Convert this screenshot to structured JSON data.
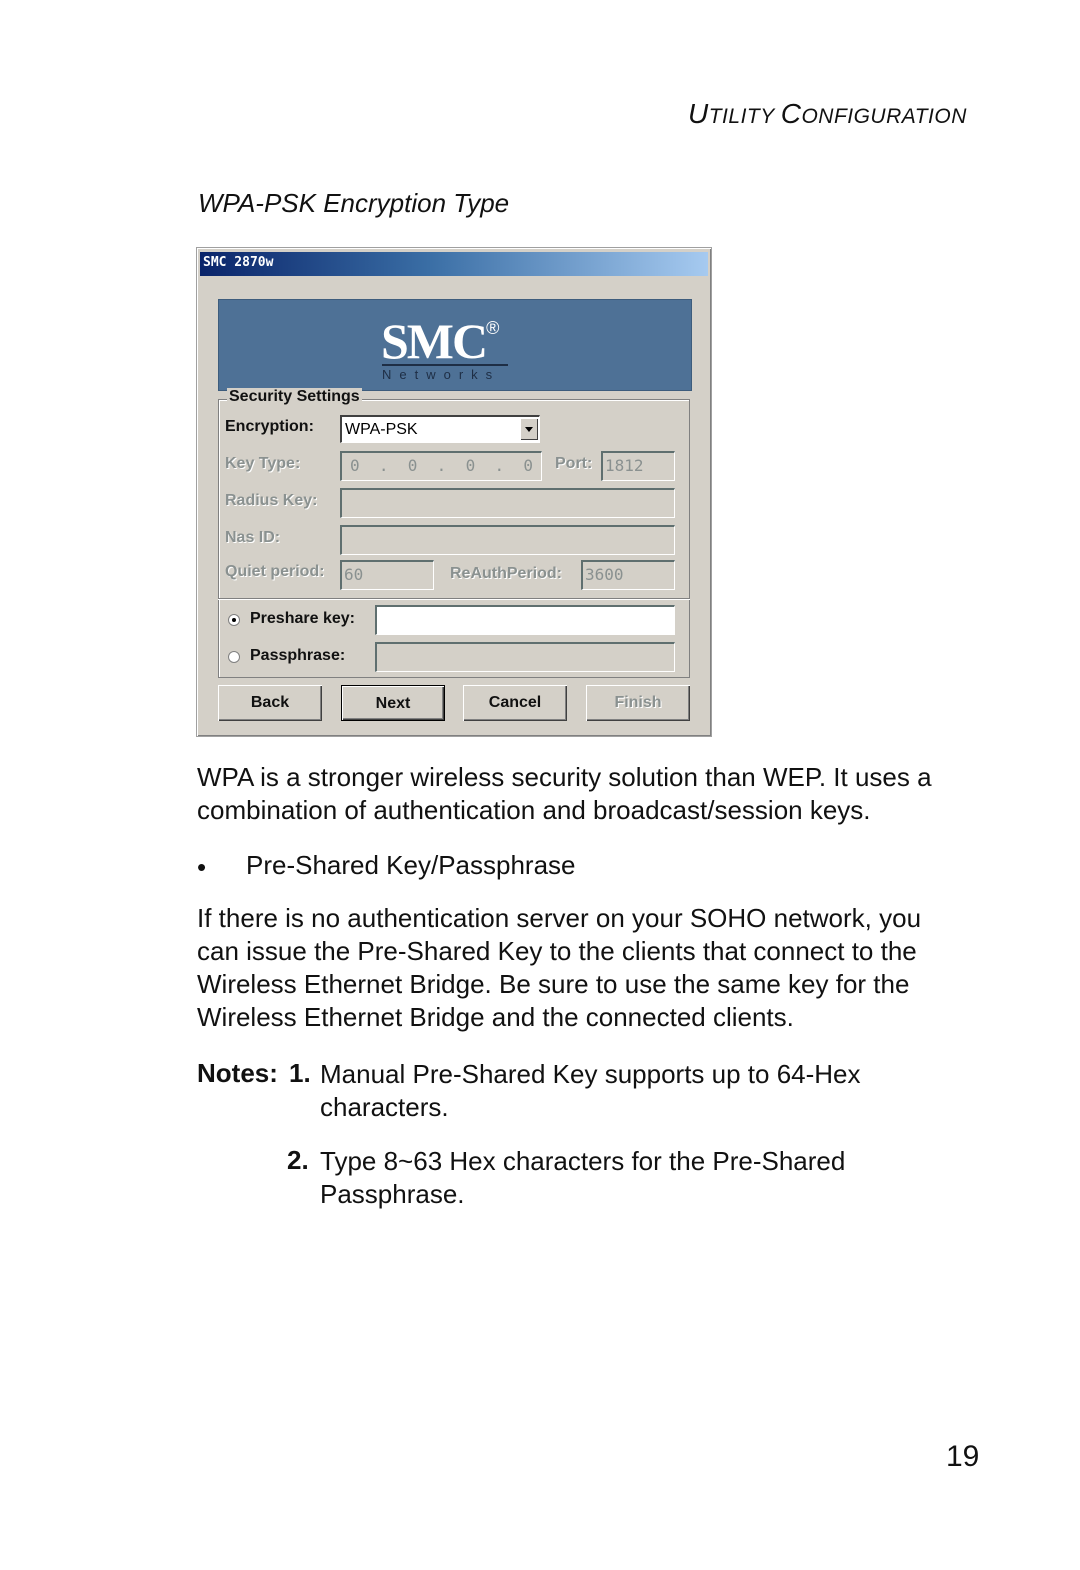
{
  "header": {
    "section_first_U": "U",
    "section_rest1": "TILITY ",
    "section_first_C": "C",
    "section_rest2": "ONFIGURATION"
  },
  "caption": "WPA-PSK Encryption Type",
  "dialog": {
    "title": "SMC 2870w",
    "logo": "SMC",
    "logo_mark": "®",
    "logo_sub": "Networks",
    "group_title": "Security Settings",
    "encryption_label": "Encryption:",
    "encryption_value": "WPA-PSK",
    "key_type_label": "Key Type:",
    "key_type_value": "0  .  0  .  0  .  0",
    "port_label": "Port:",
    "port_value": "1812",
    "radius_key_label": "Radius Key:",
    "radius_key_value": "",
    "nas_id_label": "Nas ID:",
    "nas_id_value": "",
    "quiet_period_label": "Quiet period:",
    "quiet_period_value": "60",
    "reauth_label": "ReAuthPeriod:",
    "reauth_value": "3600",
    "preshare_label": "Preshare key:",
    "preshare_value": "",
    "preshare_selected": true,
    "passphrase_label": "Passphrase:",
    "passphrase_value": "",
    "buttons": {
      "back": "Back",
      "next": "Next",
      "cancel": "Cancel",
      "finish": "Finish"
    }
  },
  "body": {
    "para1": "WPA is a stronger wireless security solution than WEP. It uses a combination of authentication and broadcast/session keys.",
    "bullet_symbol": "•",
    "bullet": "Pre-Shared Key/Passphrase",
    "para2": "If there is no authentication server on your SOHO network, you can issue the Pre-Shared Key to the clients that connect to the Wireless Ethernet Bridge. Be sure to use the same key for the Wireless Ethernet Bridge and the connected clients.",
    "notes_label": "Notes:",
    "notes": [
      {
        "num": "1.",
        "text": "Manual Pre-Shared Key supports up to 64-Hex characters."
      },
      {
        "num": "2.",
        "text": "Type 8~63 Hex characters for the Pre-Shared Passphrase."
      }
    ]
  },
  "page_number": "19"
}
